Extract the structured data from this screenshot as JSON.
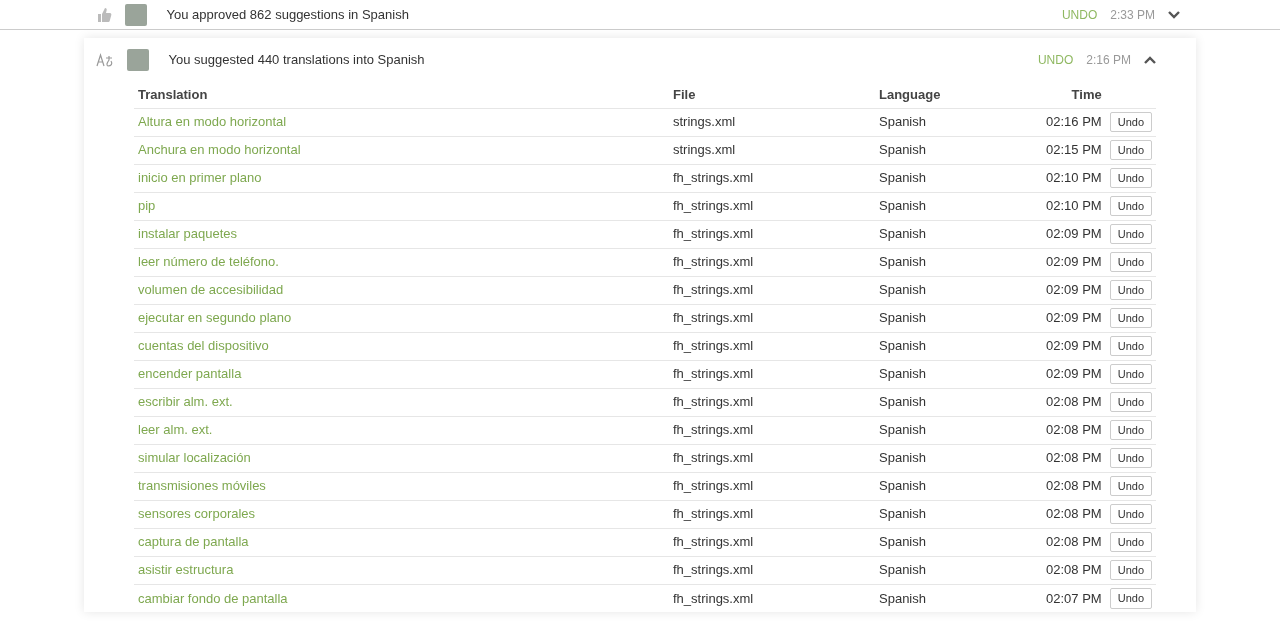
{
  "previous_activity": {
    "message": "You approved 862 suggestions in Spanish",
    "undo": "UNDO",
    "time": "2:33 PM",
    "expanded": false
  },
  "activity": {
    "message": "You suggested 440 translations into Spanish",
    "undo": "UNDO",
    "time": "2:16 PM",
    "expanded": true
  },
  "table": {
    "columns": [
      "Translation",
      "File",
      "Language",
      "Time"
    ],
    "rows": [
      {
        "translation": "Altura en modo horizontal",
        "file": "strings.xml",
        "language": "Spanish",
        "time": "02:16 PM",
        "action": "Undo"
      },
      {
        "translation": "Anchura en modo horizontal",
        "file": "strings.xml",
        "language": "Spanish",
        "time": "02:15 PM",
        "action": "Undo"
      },
      {
        "translation": "inicio en primer plano",
        "file": "fh_strings.xml",
        "language": "Spanish",
        "time": "02:10 PM",
        "action": "Undo"
      },
      {
        "translation": "pip",
        "file": "fh_strings.xml",
        "language": "Spanish",
        "time": "02:10 PM",
        "action": "Undo"
      },
      {
        "translation": "instalar paquetes",
        "file": "fh_strings.xml",
        "language": "Spanish",
        "time": "02:09 PM",
        "action": "Undo"
      },
      {
        "translation": "leer número de teléfono.",
        "file": "fh_strings.xml",
        "language": "Spanish",
        "time": "02:09 PM",
        "action": "Undo"
      },
      {
        "translation": "volumen de accesibilidad",
        "file": "fh_strings.xml",
        "language": "Spanish",
        "time": "02:09 PM",
        "action": "Undo"
      },
      {
        "translation": "ejecutar en segundo plano",
        "file": "fh_strings.xml",
        "language": "Spanish",
        "time": "02:09 PM",
        "action": "Undo"
      },
      {
        "translation": "cuentas del dispositivo",
        "file": "fh_strings.xml",
        "language": "Spanish",
        "time": "02:09 PM",
        "action": "Undo"
      },
      {
        "translation": "encender pantalla",
        "file": "fh_strings.xml",
        "language": "Spanish",
        "time": "02:09 PM",
        "action": "Undo"
      },
      {
        "translation": "escribir alm. ext.",
        "file": "fh_strings.xml",
        "language": "Spanish",
        "time": "02:08 PM",
        "action": "Undo"
      },
      {
        "translation": "leer alm. ext.",
        "file": "fh_strings.xml",
        "language": "Spanish",
        "time": "02:08 PM",
        "action": "Undo"
      },
      {
        "translation": "simular localización",
        "file": "fh_strings.xml",
        "language": "Spanish",
        "time": "02:08 PM",
        "action": "Undo"
      },
      {
        "translation": "transmisiones móviles",
        "file": "fh_strings.xml",
        "language": "Spanish",
        "time": "02:08 PM",
        "action": "Undo"
      },
      {
        "translation": "sensores corporales",
        "file": "fh_strings.xml",
        "language": "Spanish",
        "time": "02:08 PM",
        "action": "Undo"
      },
      {
        "translation": "captura de pantalla",
        "file": "fh_strings.xml",
        "language": "Spanish",
        "time": "02:08 PM",
        "action": "Undo"
      },
      {
        "translation": "asistir estructura",
        "file": "fh_strings.xml",
        "language": "Spanish",
        "time": "02:08 PM",
        "action": "Undo"
      },
      {
        "translation": "cambiar fondo de pantalla",
        "file": "fh_strings.xml",
        "language": "Spanish",
        "time": "02:07 PM",
        "action": "Undo"
      }
    ]
  }
}
